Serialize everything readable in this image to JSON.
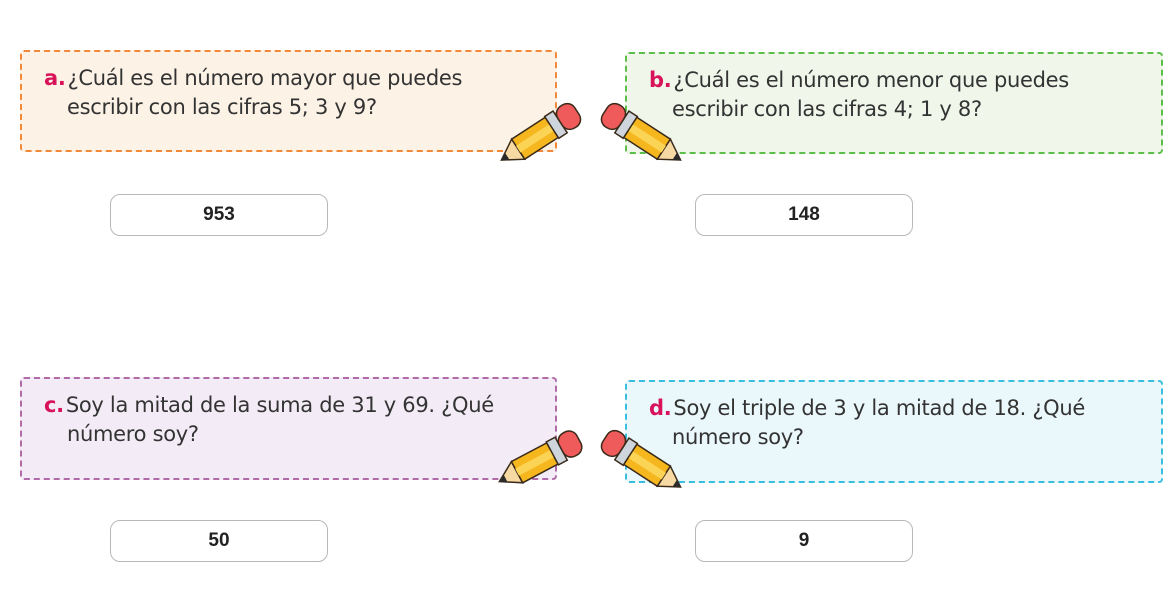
{
  "colors": {
    "letter": "#d8135a",
    "card_a_border": "#f08a3a",
    "card_a_bg": "#fdf2e6",
    "card_b_border": "#5cbf4a",
    "card_b_bg": "#f0f6ea",
    "card_c_border": "#b06aa8",
    "card_c_bg": "#f3ecf6",
    "card_d_border": "#38bfe0",
    "card_d_bg": "#eaf7fb"
  },
  "questions": [
    {
      "letter": "a.",
      "line1": "¿Cuál es el número mayor que puedes",
      "line2": "escribir con las cifras 5; 3 y 9?",
      "answer": "953",
      "icon": "pencil-icon"
    },
    {
      "letter": "b.",
      "line1": "¿Cuál es el número menor que puedes",
      "line2": "escribir con las cifras 4; 1 y 8?",
      "answer": "148",
      "icon": "pencil-icon"
    },
    {
      "letter": "c.",
      "line1": "Soy la mitad de la suma de 31 y 69. ¿Qué",
      "line2": "número soy?",
      "answer": "50",
      "icon": "pencil-icon"
    },
    {
      "letter": "d.",
      "line1": "Soy el triple de 3 y la mitad de 18. ¿Qué",
      "line2": "número soy?",
      "answer": "9",
      "icon": "pencil-icon"
    }
  ]
}
